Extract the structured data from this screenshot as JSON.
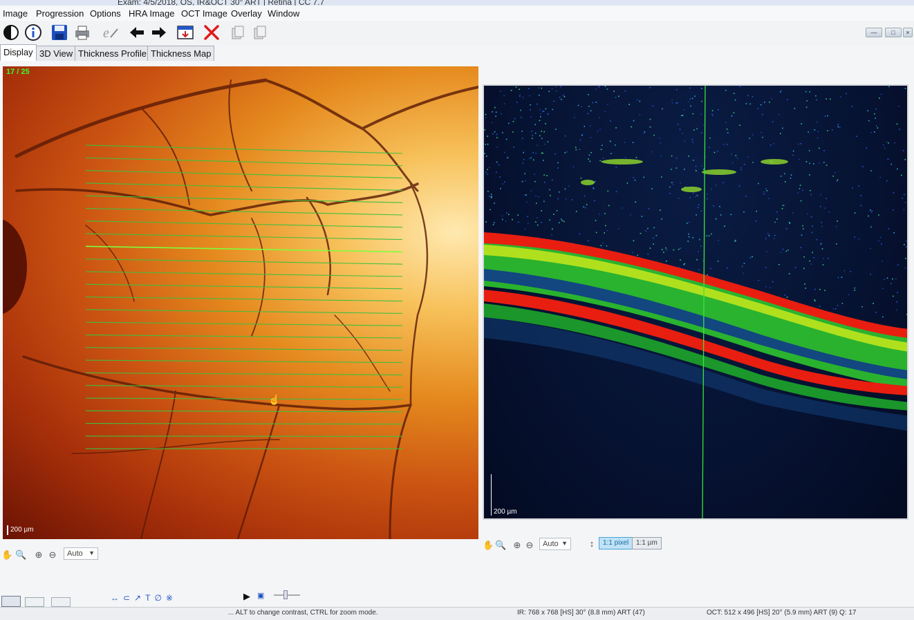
{
  "window": {
    "title": "Exam: 4/5/2018, OS, IR&OCT 30° ART  |  Retina  |  CC 7.7"
  },
  "menu": [
    "Image",
    "Progression",
    "Options",
    "HRA Image",
    "OCT Image",
    "Overlay",
    "Window"
  ],
  "toolbar": {
    "icons": [
      "contrast-icon",
      "info-icon",
      "save-icon",
      "print-icon",
      "edit-icon",
      "back-arrow-icon",
      "forward-arrow-icon",
      "export-icon",
      "delete-icon",
      "copy-icon",
      "paste-icon"
    ]
  },
  "tabs": [
    {
      "label": "Display",
      "active": true
    },
    {
      "label": "3D View",
      "active": false
    },
    {
      "label": "Thickness Profile",
      "active": false
    },
    {
      "label": "Thickness Map",
      "active": false
    }
  ],
  "fundus": {
    "scan_counter": "17 / 25",
    "scale_label": "200 µm",
    "scan_lines_total": 25,
    "selected_scan": 17,
    "line_color": "#3fbf3f",
    "selected_line_color": "#7dff3a"
  },
  "oct": {
    "scale_label": "200 µm",
    "marker_color": "#37e637"
  },
  "left_controls": {
    "zoom_value": "Auto"
  },
  "right_controls": {
    "zoom_value": "Auto",
    "pixel_button": "1:1 pixel",
    "um_button": "1:1 µm"
  },
  "status": {
    "hint": "... ALT to change contrast, CTRL for zoom mode.",
    "ir_info": "IR: 768 x 768 [HS] 30° (8.8 mm) ART (47)",
    "oct_info": "OCT: 512 x 496 [HS] 20° (5.9 mm) ART (9) Q: 17"
  },
  "colors": {
    "accent_green": "#35ff35",
    "button_active": "#bfe2f7"
  }
}
